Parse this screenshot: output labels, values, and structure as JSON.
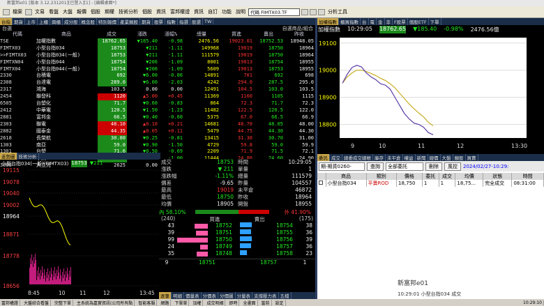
{
  "window": {
    "title": "新富邦e01 [版本 3.12.231201][已登入][1] - [編輯桌面*]"
  },
  "menu": {
    "items": [
      "檔案",
      "文易",
      "看盤",
      "大盤",
      "報價",
      "個股",
      "期權",
      "技術分析",
      "個股",
      "資訊",
      "富邦權證",
      "資訊",
      "自訂",
      "功能",
      "說明"
    ],
    "code_value": "代碼 FIMTX03.TF",
    "tool": "分析工具"
  },
  "tabs": {
    "quote": [
      "台指",
      "期貨",
      "上市",
      "上櫃",
      "興櫃",
      "成分股",
      "概念股",
      "特別報價",
      "產業類股",
      "期貨",
      "股票",
      "指數",
      "指選",
      "股選",
      "TW"
    ],
    "index": [
      "加權指數",
      "櫃買指數",
      "台",
      "電",
      "金",
      "非",
      "F股票",
      "個股ETF",
      "下單"
    ],
    "quote_sub": "台選",
    "quote_sub2": "自選商品/組合",
    "order": [
      "委託",
      "成交",
      "總委成交總帳",
      "庫存",
      "未平倉",
      "權益",
      "新聞",
      "總價",
      "大盤",
      "類股",
      "買賣"
    ],
    "tech": [
      "走勢圖",
      "技術分析"
    ],
    "detail": [
      "逐筆",
      "明細",
      "價量表",
      "分價表",
      "分價圖",
      "分量表",
      "支撐壓力表",
      "五檔"
    ]
  },
  "quote_table": {
    "headers": [
      "代碼",
      "商品",
      "成交",
      "漲跌",
      "漲幅%",
      "總量",
      "買進",
      "賣出",
      "昨收"
    ],
    "rows": [
      {
        "code": "TSE",
        "name": "加權指數",
        "price": "18762.65",
        "chg": "▼185.40",
        "pct": "-0.98",
        "vol": "2476.56",
        "bid": "19023.01",
        "ask": "18752.53",
        "prev": "18948.05",
        "dir": "dn"
      },
      {
        "code": "FIMTX03",
        "name": "小型台指034",
        "price": "18753",
        "chg": "▼211",
        "pct": "-1.11",
        "vol": "149968",
        "bid": "19019",
        "ask": "18750",
        "prev": "18964",
        "dir": "dn"
      },
      {
        "code": ">>FIMTX03",
        "name": "小型台指034(一般)",
        "price": "18753",
        "chg": "▼211",
        "pct": "-1.11",
        "vol": "111579",
        "bid": "19019",
        "ask": "18750",
        "prev": "18964",
        "dir": "dn"
      },
      {
        "code": "FIMTXN04",
        "name": "小型台指044",
        "price": "18754",
        "chg": "▼206",
        "pct": "-1.09",
        "vol": "8001",
        "bid": "19013",
        "ask": "18754",
        "prev": "18955",
        "dir": "dn"
      },
      {
        "code": "FIMTX04",
        "name": "小型台指044(一般)",
        "price": "18754",
        "chg": "▼206",
        "pct": "-1.09",
        "vol": "5609",
        "bid": "19013",
        "ask": "18753",
        "prev": "18955",
        "dir": "dn"
      },
      {
        "code": "2330",
        "name": "台積電",
        "price": "692",
        "chg": "▼6.00",
        "pct": "-0.86",
        "vol": "14891",
        "bid": "701",
        "ask": "692",
        "prev": "698",
        "dir": "dn"
      },
      {
        "code": "2308",
        "name": "台達電",
        "price": "289.0",
        "chg": "▼6.00",
        "pct": "-2.03",
        "vol": "4242",
        "bid": "294.0",
        "ask": "287.5",
        "prev": "295.0",
        "dir": "dn"
      },
      {
        "code": "2317",
        "name": "鴻海",
        "price": "103.5",
        "chg": "0.00",
        "pct": "0.00",
        "vol": "12491",
        "bid": "104.5",
        "ask": "103.0",
        "prev": "103.5",
        "dir": "wh"
      },
      {
        "code": "2454",
        "name": "聯發科",
        "price": "1120",
        "chg": "▲5.00",
        "pct": "+0.45",
        "vol": "11369",
        "bid": "1160",
        "ask": "1105",
        "prev": "1115",
        "dir": "up"
      },
      {
        "code": "6505",
        "name": "台塑化",
        "price": "71.7",
        "chg": "▼0.60",
        "pct": "-0.83",
        "vol": "864",
        "bid": "72.3",
        "ask": "71.7",
        "prev": "72.3",
        "dir": "dn"
      },
      {
        "code": "2412",
        "name": "中華電",
        "price": "120.5",
        "chg": "▼1.50",
        "pct": "-1.23",
        "vol": "11482",
        "bid": "122.5",
        "ask": "120.5",
        "prev": "122.0",
        "dir": "dn"
      },
      {
        "code": "2881",
        "name": "富邦金",
        "price": "66.5",
        "chg": "▼0.40",
        "pct": "-0.60",
        "vol": "5375",
        "bid": "67.0",
        "ask": "66.5",
        "prev": "66.9",
        "dir": "dn"
      },
      {
        "code": "2303",
        "name": "聯電",
        "price": "48.10",
        "chg": "▲0.10",
        "pct": "+0.21",
        "vol": "14681",
        "bid": "48.70",
        "ask": "48.05",
        "prev": "48.00",
        "dir": "up"
      },
      {
        "code": "2882",
        "name": "國泰金",
        "price": "44.35",
        "chg": "▲0.05",
        "pct": "+0.11",
        "vol": "5479",
        "bid": "44.75",
        "ask": "44.30",
        "prev": "44.30",
        "dir": "up"
      },
      {
        "code": "2618",
        "name": "長榮航",
        "price": "30.80",
        "chg": "▼0.25",
        "pct": "-0.81",
        "vol": "13415",
        "bid": "31.30",
        "ask": "30.70",
        "prev": "31.00",
        "dir": "dn"
      },
      {
        "code": "1303",
        "name": "南亞",
        "price": "59.0",
        "chg": "▼0.90",
        "pct": "-1.50",
        "vol": "4729",
        "bid": "59.8",
        "ask": "59.0",
        "prev": "59.9",
        "dir": "dn"
      },
      {
        "code": "1301",
        "name": "台塑",
        "price": "71.6",
        "chg": "▼0.50",
        "pct": "-0.69",
        "vol": "2209",
        "bid": "71.9",
        "ask": "71.5",
        "prev": "72.1",
        "dir": "dn"
      },
      {
        "code": "2002",
        "name": "中鋼",
        "price": "24.65",
        "chg": "▼0.25",
        "pct": "-1.00",
        "vol": "11444",
        "bid": "24.80",
        "ask": "24.60",
        "prev": "24.90",
        "dir": "dn"
      },
      {
        "code": "3008",
        "name": "大立光",
        "price": "2625",
        "chg": "0.00",
        "pct": "0.00",
        "vol": "626",
        "bid": "2665",
        "ask": "2650",
        "prev": "2625",
        "dir": "wh"
      }
    ]
  },
  "index_panel": {
    "name": "加權指數",
    "time": "10:29:05",
    "price": "18762.65",
    "chg": "▼185.40",
    "pct": "-0.98%",
    "vol": "2476.56億",
    "ylabels": [
      "19100",
      "19000",
      "18900",
      "18800"
    ],
    "xlabels": [
      "9",
      "10",
      "11",
      "12",
      "13:30"
    ],
    "series": [
      18952,
      18985,
      19010,
      19018,
      19012,
      18990,
      18975,
      18965,
      18950,
      18945,
      18930,
      18900,
      18870,
      18840,
      18820,
      18805,
      18800,
      18790,
      18770,
      18762
    ],
    "avg": [
      18952,
      18975,
      18990,
      19000,
      19000,
      18995,
      18988,
      18980,
      18970,
      18962,
      18950,
      18935,
      18915,
      18895,
      18875,
      18858,
      18842,
      18828,
      18808,
      18795
    ]
  },
  "tech_panel": {
    "title": "小型台指034(一般)(FIMTX03)",
    "price": "18753",
    "chg": "▼211",
    "ylabels": [
      "19115",
      "19078",
      "19040",
      "19002",
      "18964",
      "18871",
      "18778",
      "18656"
    ],
    "xlabels": [
      "8:45",
      "10",
      "11",
      "12",
      "13:45"
    ]
  },
  "detail": {
    "rows": [
      [
        "成交",
        "18753",
        "時間",
        "10:29:05"
      ],
      [
        "漲跌",
        "▼ 211",
        "單量",
        "1"
      ],
      [
        "漲跌幅",
        "-1.11%",
        "總量",
        "111579"
      ],
      [
        "價差",
        "-9.65",
        "昨量",
        "104557"
      ],
      [
        "最高",
        "19019",
        "未平倉",
        "46872"
      ],
      [
        "最低",
        "18750",
        "昨收",
        "18964"
      ],
      [
        "均價",
        "18905",
        "開盤",
        "18955"
      ]
    ],
    "in_pct": "內 58.10%",
    "out_pct": "外 41.90%",
    "bid_total": "(240)",
    "ask_total": "(175)",
    "bid_label": "買進",
    "ask_label": "賣出",
    "book": [
      [
        "43",
        "18752",
        "18754",
        "38"
      ],
      [
        "39",
        "18751",
        "18755",
        "36"
      ],
      [
        "99",
        "18750",
        "18756",
        "39"
      ],
      [
        "24",
        "18749",
        "18757",
        "36"
      ],
      [
        "35",
        "18748",
        "18758",
        "23"
      ]
    ],
    "last": [
      "9",
      "18751",
      "18757",
      "1"
    ]
  },
  "order": {
    "filter": "期-期貨0260-",
    "query": "查詢",
    "all": "全部委託",
    "del": "刪除",
    "control": "風控",
    "date": "2024/02/27-10:29:",
    "headers": [
      "商品",
      "類別",
      "價格",
      "委託",
      "成交",
      "均價",
      "狀態",
      "時間"
    ],
    "row": [
      "小型台指034",
      "平賣ROD",
      "18,750",
      "1",
      "1",
      "18,75...",
      "完全成交",
      "08:31:00"
    ],
    "footer": "新富邦e01",
    "footer2": "10:29:01 小型台指034 成交"
  },
  "statusbar": {
    "items": [
      "富邦權證",
      "大盤綜合看盤",
      "完整下單",
      "主系統為嘉實資訊(公司所有點",
      "智能客服",
      "網路",
      "下單單",
      "加權",
      "成交明細",
      "即時",
      "全畫面",
      "當前",
      "設定"
    ],
    "time": "10:29:10"
  }
}
